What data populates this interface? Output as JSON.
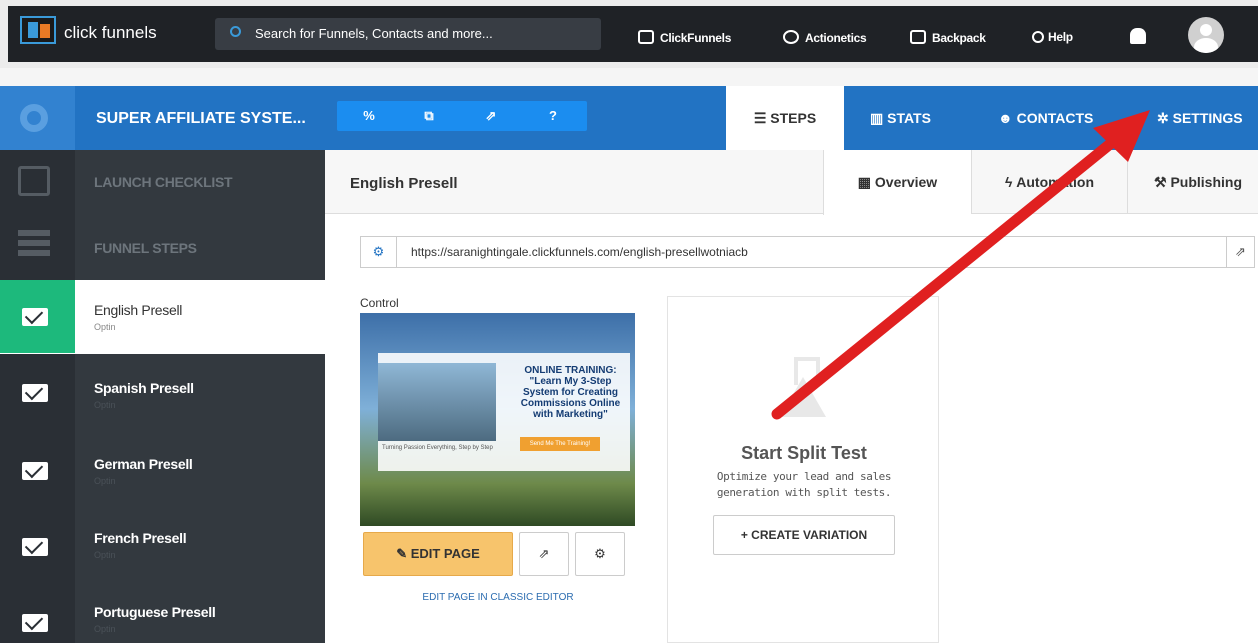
{
  "topbar": {
    "brand": "click funnels",
    "search_placeholder": "Search for Funnels, Contacts and more...",
    "nav": [
      "ClickFunnels",
      "Actionetics",
      "Backpack",
      "Help"
    ]
  },
  "funnel": {
    "title": "SUPER AFFILIATE SYSTE...",
    "tabs": [
      "STEPS",
      "STATS",
      "CONTACTS",
      "SETTINGS"
    ],
    "tool_icons": [
      "link-icon",
      "copy-icon",
      "external-link-icon",
      "help-icon"
    ]
  },
  "sidebar": {
    "launch_checklist": "LAUNCH CHECKLIST",
    "funnel_steps": "FUNNEL STEPS",
    "steps": [
      {
        "name": "English Presell",
        "type": "Optin"
      },
      {
        "name": "Spanish Presell",
        "type": "Optin"
      },
      {
        "name": "German Presell",
        "type": "Optin"
      },
      {
        "name": "French Presell",
        "type": "Optin"
      },
      {
        "name": "Portuguese Presell",
        "type": "Optin"
      }
    ]
  },
  "step": {
    "title": "English Presell",
    "tabs": [
      "Overview",
      "Automation",
      "Publishing"
    ],
    "url": "https://saranightingale.clickfunnels.com/english-presellwotniacb",
    "control_label": "Control",
    "preview": {
      "headline": "ONLINE TRAINING: \"Learn My 3-Step System for Creating Commissions Online with Marketing\"",
      "sub": "Turning Passion Everything, Step by Step",
      "button": "Send Me The Training!"
    },
    "edit_page": "EDIT PAGE",
    "classic_editor": "EDIT PAGE IN CLASSIC EDITOR"
  },
  "split": {
    "title": "Start Split Test",
    "text": "Optimize your lead and sales generation with split tests.",
    "button": "CREATE VARIATION"
  },
  "colors": {
    "primary": "#2273c3",
    "sidebar": "#33393f",
    "active_step": "#1db97c",
    "edit": "#f7c46c",
    "arrow": "#e02020"
  }
}
